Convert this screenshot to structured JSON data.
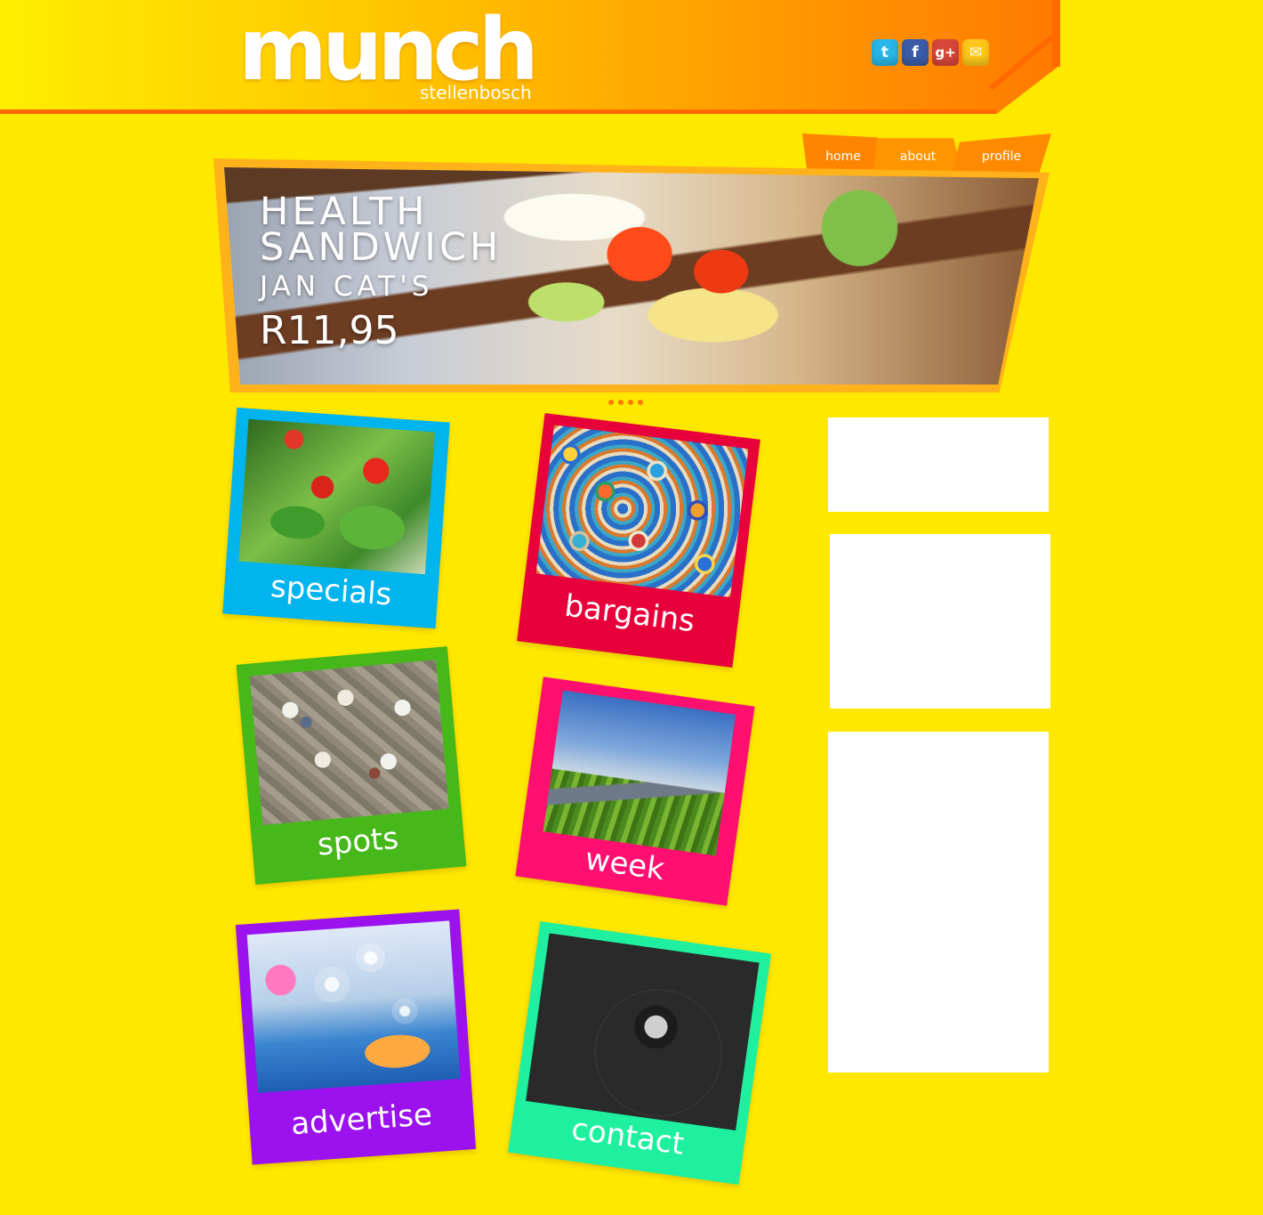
{
  "brand": {
    "name": "munch",
    "tagline": "stellenbosch"
  },
  "social": [
    {
      "icon": "twitter-icon",
      "glyph": "t"
    },
    {
      "icon": "facebook-icon",
      "glyph": "f"
    },
    {
      "icon": "google-plus-icon",
      "glyph": "g+"
    },
    {
      "icon": "email-icon",
      "glyph": "✉"
    }
  ],
  "nav": {
    "home": "home",
    "about": "about",
    "profile": "profile"
  },
  "hero": {
    "line1": "HEALTH",
    "line2": "SANDWICH",
    "line3": "JAN CAT'S",
    "price": "R11,95"
  },
  "carousel_dots": 4,
  "categories": {
    "specials": "specials",
    "bargains": "bargains",
    "spots": "spots",
    "week": "week",
    "advertise": "advertise",
    "contact": "contact"
  },
  "colors": {
    "background": "#ffe800",
    "header_orange": "#ff7a00",
    "specials": "#00b4ee",
    "bargains": "#e8003a",
    "spots": "#46b81a",
    "week": "#ff1070",
    "advertise": "#9b12ee",
    "contact": "#1ff0a0"
  }
}
